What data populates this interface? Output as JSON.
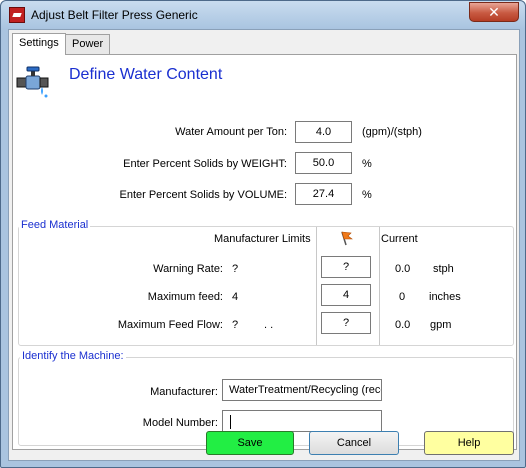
{
  "window": {
    "title": "Adjust Belt Filter Press Generic",
    "close_glyph": "✕"
  },
  "tabs": [
    {
      "label": "Settings",
      "active": true
    },
    {
      "label": "Power",
      "active": false
    }
  ],
  "header": {
    "title": "Define Water Content",
    "icon": "water-valve-icon"
  },
  "water": {
    "amount_label": "Water Amount per Ton:",
    "amount_value": "4.0",
    "amount_unit": "(gpm)/(stph)",
    "weight_label": "Enter Percent Solids by WEIGHT:",
    "weight_value": "50.0",
    "weight_unit": "%",
    "volume_label": "Enter Percent Solids by VOLUME:",
    "volume_value": "27.4",
    "volume_unit": "%"
  },
  "feed": {
    "group_title": "Feed Material",
    "col_manufacturer": "Manufacturer Limits",
    "col_flag_icon": "orange-flag-icon",
    "col_current": "Current",
    "rows": [
      {
        "label": "Warning Rate:",
        "limit": "?",
        "limit_extra": "",
        "value": "?",
        "current": "0.0",
        "unit": "stph"
      },
      {
        "label": "Maximum feed:",
        "limit": "4",
        "limit_extra": "",
        "value": "4",
        "current": "0",
        "unit": "inches"
      },
      {
        "label": "Maximum Feed Flow:",
        "limit": "?",
        "limit_extra": ". .",
        "value": "?",
        "current": "0.0",
        "unit": "gpm"
      }
    ]
  },
  "machine": {
    "group_title": "Identify the Machine:",
    "manufacturer_label": "Manufacturer:",
    "manufacturer_value": "WaterTreatment/Recycling (reco",
    "model_label": "Model Number:",
    "model_value": ""
  },
  "buttons": {
    "save": "Save",
    "cancel": "Cancel",
    "help": "Help"
  },
  "colors": {
    "title_blue": "#1a2fd0",
    "save_green": "#22ee44",
    "help_yellow": "#ffffa0"
  }
}
